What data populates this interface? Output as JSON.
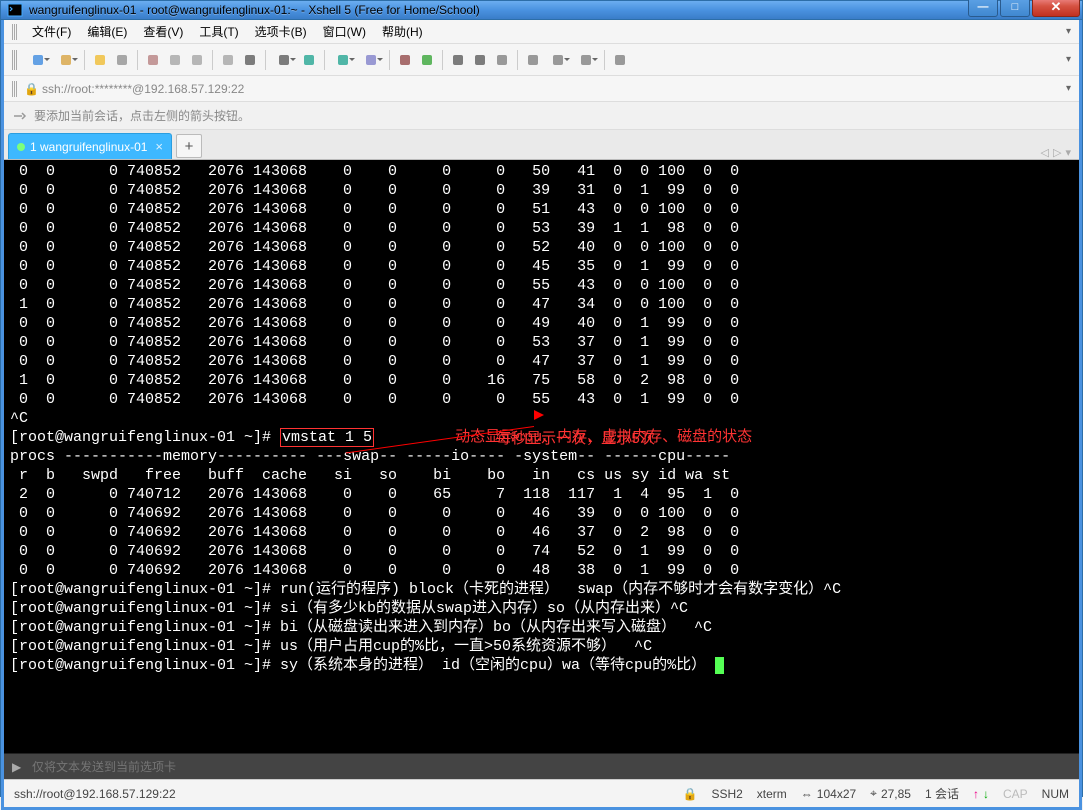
{
  "window_title": "wangruifenglinux-01 - root@wangruifenglinux-01:~ - Xshell 5 (Free for Home/School)",
  "menubar": [
    "文件(F)",
    "编辑(E)",
    "查看(V)",
    "工具(T)",
    "选项卡(B)",
    "窗口(W)",
    "帮助(H)"
  ],
  "address_bar": "ssh://root:********@192.168.57.129:22",
  "hint_text": "要添加当前会话，点击左侧的箭头按钮。",
  "tab_label": "1 wangruifenglinux-01",
  "sendbar_placeholder": "仅将文本发送到当前选项卡",
  "status_left": "ssh://root@192.168.57.129:22",
  "status_lock": "🔒",
  "status_ssh": "SSH2",
  "status_term": "xterm",
  "status_size": "104x27",
  "status_pos": "27,85",
  "status_sess": "1 会话",
  "status_cap": "CAP",
  "status_num": "NUM",
  "annotation1": "动态显示cpu、内存、虚拟内存、磁盘的状态",
  "annotation2": "每秒显示一次，显示5次",
  "prompt": "[root@wangruifenglinux-01 ~]# ",
  "cmd_vmstat": "vmstat 1 5",
  "vmstat_header1": "procs -----------memory---------- ---swap-- -----io---- -system-- ------cpu-----",
  "vmstat_header2": " r  b   swpd   free   buff  cache   si   so    bi    bo   in   cs us sy id wa st",
  "top_rows": [
    " 0  0      0 740852   2076 143068    0    0     0     0   50   41  0  0 100  0  0",
    " 0  0      0 740852   2076 143068    0    0     0     0   39   31  0  1  99  0  0",
    " 0  0      0 740852   2076 143068    0    0     0     0   51   43  0  0 100  0  0",
    " 0  0      0 740852   2076 143068    0    0     0     0   53   39  1  1  98  0  0",
    " 0  0      0 740852   2076 143068    0    0     0     0   52   40  0  0 100  0  0",
    " 0  0      0 740852   2076 143068    0    0     0     0   45   35  0  1  99  0  0",
    " 0  0      0 740852   2076 143068    0    0     0     0   55   43  0  0 100  0  0",
    " 1  0      0 740852   2076 143068    0    0     0     0   47   34  0  0 100  0  0",
    " 0  0      0 740852   2076 143068    0    0     0     0   49   40  0  1  99  0  0",
    " 0  0      0 740852   2076 143068    0    0     0     0   53   37  0  1  99  0  0",
    " 0  0      0 740852   2076 143068    0    0     0     0   47   37  0  1  99  0  0",
    " 1  0      0 740852   2076 143068    0    0     0    16   75   58  0  2  98  0  0",
    " 0  0      0 740852   2076 143068    0    0     0     0   55   43  0  1  99  0  0"
  ],
  "vmstat_rows": [
    " 2  0      0 740712   2076 143068    0    0    65     7  118  117  1  4  95  1  0",
    " 0  0      0 740692   2076 143068    0    0     0     0   46   39  0  0 100  0  0",
    " 0  0      0 740692   2076 143068    0    0     0     0   46   37  0  2  98  0  0",
    " 0  0      0 740692   2076 143068    0    0     0     0   74   52  0  1  99  0  0",
    " 0  0      0 740692   2076 143068    0    0     0     0   48   38  0  1  99  0  0"
  ],
  "ctrl_c": "^C",
  "cmd_run": "run(运行的程序) block（卡死的进程）  swap（内存不够时才会有数字变化）^C",
  "cmd_si": "si（有多少kb的数据从swap进入内存）so（从内存出来）^C",
  "cmd_bi": "bi（从磁盘读出来进入到内存）bo（从内存出来写入磁盘）  ^C",
  "cmd_us": "us（用户占用cup的%比，一直>50系统资源不够）  ^C",
  "cmd_sy": "sy（系统本身的进程） id（空闲的cpu）wa（等待cpu的%比）",
  "toolbar_icons": [
    {
      "name": "new-session-icon",
      "color": "#4a92e0",
      "dd": true
    },
    {
      "name": "open-icon",
      "color": "#d9a84c",
      "dd": true
    },
    {
      "name": "highlighter-icon",
      "color": "#f0c040"
    },
    {
      "name": "scissors-icon",
      "color": "#999"
    },
    {
      "name": "reconnect-icon",
      "color": "#b88"
    },
    {
      "name": "disconnect-icon",
      "color": "#aaa"
    },
    {
      "name": "copy-icon",
      "color": "#aaa"
    },
    {
      "name": "paste-icon",
      "color": "#aaa"
    },
    {
      "name": "search-icon",
      "color": "#666"
    },
    {
      "name": "print-icon",
      "color": "#666",
      "dd": true
    },
    {
      "name": "properties-icon",
      "color": "#3a9"
    },
    {
      "name": "globe-icon",
      "color": "#3a9",
      "dd": true
    },
    {
      "name": "font-icon",
      "color": "#88c",
      "dd": true
    },
    {
      "name": "color-icon",
      "color": "#955"
    },
    {
      "name": "refresh-icon",
      "color": "#4a4"
    },
    {
      "name": "tile-icon",
      "color": "#666"
    },
    {
      "name": "expand-icon",
      "color": "#666"
    },
    {
      "name": "lock-icon",
      "color": "#888"
    },
    {
      "name": "columns-icon",
      "color": "#888"
    },
    {
      "name": "layout-icon",
      "color": "#888",
      "dd": true
    },
    {
      "name": "list-icon",
      "color": "#888",
      "dd": true
    },
    {
      "name": "help-icon",
      "color": "#888"
    }
  ]
}
